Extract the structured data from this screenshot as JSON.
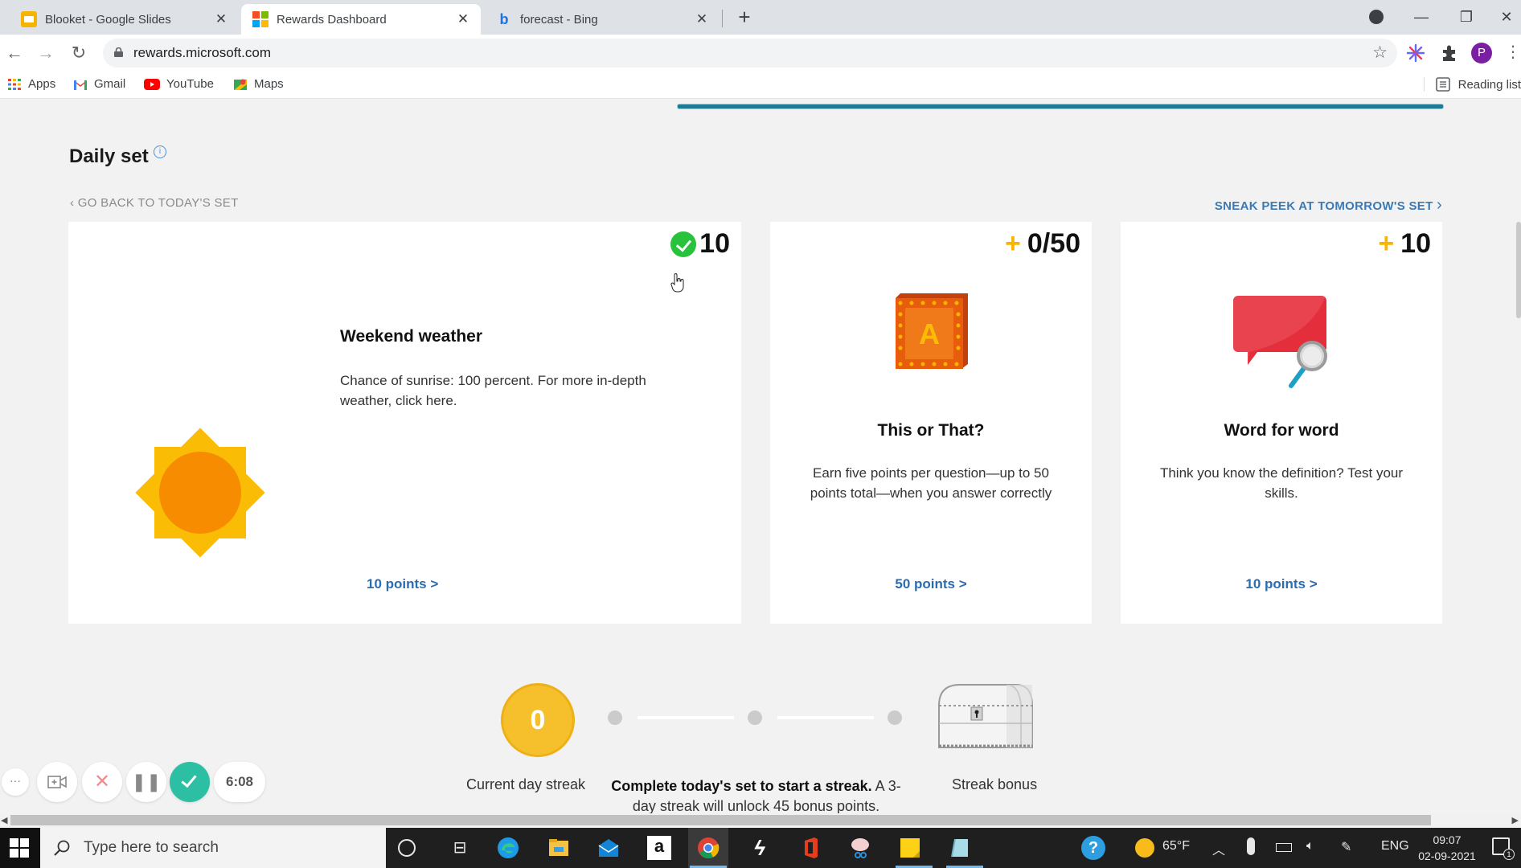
{
  "browser": {
    "tabs": [
      {
        "title": "Blooket - Google Slides",
        "favicon": "google-slides-icon",
        "active": false
      },
      {
        "title": "Rewards Dashboard",
        "favicon": "microsoft-icon",
        "active": true
      },
      {
        "title": "forecast - Bing",
        "favicon": "bing-icon",
        "active": false
      }
    ],
    "close_glyph": "✕",
    "new_tab_glyph": "+",
    "url": "rewards.microsoft.com",
    "profile_initial": "P",
    "bookmarks": [
      {
        "label": "Apps",
        "icon": "apps-grid-icon"
      },
      {
        "label": "Gmail",
        "icon": "gmail-icon"
      },
      {
        "label": "YouTube",
        "icon": "youtube-icon"
      },
      {
        "label": "Maps",
        "icon": "maps-icon"
      }
    ],
    "reading_list": "Reading list"
  },
  "daily_set": {
    "title": "Daily set",
    "info_glyph": "i",
    "go_back": "GO BACK TO TODAY'S SET",
    "sneak_peek": "SNEAK PEEK AT TOMORROW'S SET",
    "cards": [
      {
        "title": "Weekend weather",
        "description": "Chance of sunrise: 100 percent. For more in-depth weather, click here.",
        "points_badge": "10",
        "completed": true,
        "link": "10 points >",
        "icon": "sun-icon"
      },
      {
        "title": "This or That?",
        "description": "Earn five points per question—up to 50 points total—when you answer correctly",
        "points_badge": "0/50",
        "completed": false,
        "link": "50 points >",
        "icon": "letter-block-icon"
      },
      {
        "title": "Word for word",
        "description": "Think you know the definition? Test your skills.",
        "points_badge": "10",
        "completed": false,
        "link": "10 points >",
        "icon": "speech-bubble-search-icon"
      }
    ],
    "plus_glyph": "+"
  },
  "streak": {
    "current_value": "0",
    "current_label": "Current day streak",
    "message_bold": "Complete today's set to start a streak.",
    "message_rest": " A 3-day streak will unlock 45 bonus points.",
    "bonus_label": "Streak bonus"
  },
  "recorder": {
    "more_glyph": "···",
    "timer": "6:08"
  },
  "taskbar": {
    "search_placeholder": "Type here to search",
    "weather_temp": "65°F",
    "language": "ENG",
    "time": "09:07",
    "date": "02-09-2021",
    "notification_count": "1"
  }
}
